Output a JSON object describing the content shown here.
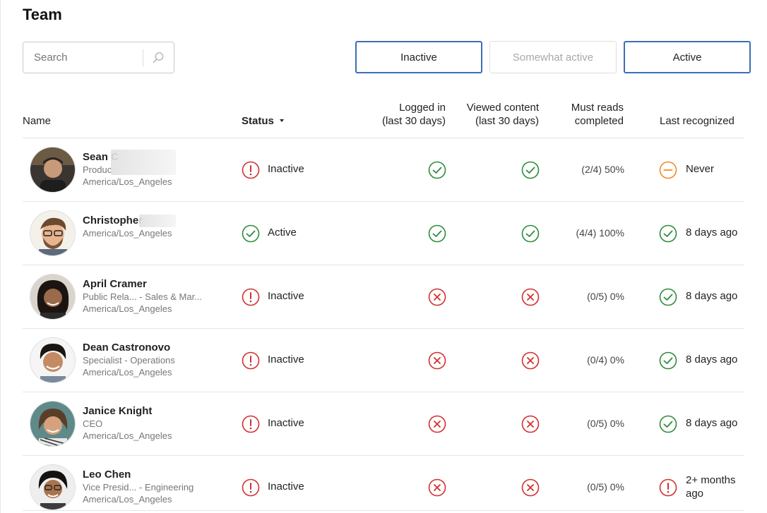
{
  "page": {
    "title": "Team"
  },
  "search": {
    "placeholder": "Search",
    "value": ""
  },
  "filters": [
    {
      "label": "Inactive",
      "selected": true
    },
    {
      "label": "Somewhat active",
      "selected": false
    },
    {
      "label": "Active",
      "selected": true
    }
  ],
  "columns": {
    "name": "Name",
    "status": "Status",
    "logged_in": [
      "Logged in",
      "(last 30 days)"
    ],
    "viewed": [
      "Viewed content",
      "(last 30 days)"
    ],
    "must_reads": [
      "Must reads",
      "completed"
    ],
    "last_recognized": "Last recognized"
  },
  "colors": {
    "accent_border": "#3b6fb6",
    "success_green": "#2e8b3a",
    "error_red": "#d32f2f",
    "warning_orange": "#f08a24"
  },
  "rows": [
    {
      "name": "Sean C",
      "role": "Produc",
      "timezone": "America/Los_Angeles",
      "status": "Inactive",
      "status_icon": "alert-icon",
      "logged_in": "check-icon",
      "viewed": "check-icon",
      "must_reads": "(2/4) 50%",
      "last_recognized": "Never",
      "last_icon": "minus-icon"
    },
    {
      "name": "Christopher",
      "role": "",
      "timezone": "America/Los_Angeles",
      "status": "Active",
      "status_icon": "check-icon",
      "logged_in": "check-icon",
      "viewed": "check-icon",
      "must_reads": "(4/4) 100%",
      "last_recognized": "8 days ago",
      "last_icon": "check-icon"
    },
    {
      "name": "April Cramer",
      "role": "Public Rela... - Sales & Mar...",
      "timezone": "America/Los_Angeles",
      "status": "Inactive",
      "status_icon": "alert-icon",
      "logged_in": "x-icon",
      "viewed": "x-icon",
      "must_reads": "(0/5) 0%",
      "last_recognized": "8 days ago",
      "last_icon": "check-icon"
    },
    {
      "name": "Dean Castronovo",
      "role": "Specialist - Operations",
      "timezone": "America/Los_Angeles",
      "status": "Inactive",
      "status_icon": "alert-icon",
      "logged_in": "x-icon",
      "viewed": "x-icon",
      "must_reads": "(0/4) 0%",
      "last_recognized": "8 days ago",
      "last_icon": "check-icon"
    },
    {
      "name": "Janice Knight",
      "role": "CEO",
      "timezone": "America/Los_Angeles",
      "status": "Inactive",
      "status_icon": "alert-icon",
      "logged_in": "x-icon",
      "viewed": "x-icon",
      "must_reads": "(0/5) 0%",
      "last_recognized": "8 days ago",
      "last_icon": "check-icon"
    },
    {
      "name": "Leo Chen",
      "role": "Vice Presid... - Engineering",
      "timezone": "America/Los_Angeles",
      "status": "Inactive",
      "status_icon": "alert-icon",
      "logged_in": "x-icon",
      "viewed": "x-icon",
      "must_reads": "(0/5) 0%",
      "last_recognized": "2+ months ago",
      "last_icon": "alert-icon"
    }
  ]
}
